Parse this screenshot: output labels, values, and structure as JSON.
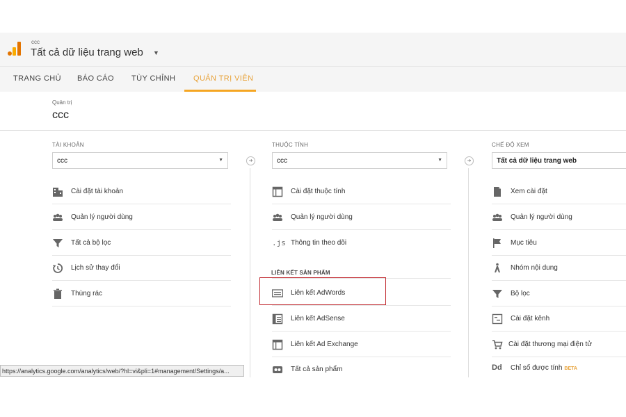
{
  "header": {
    "account_small": "ccc",
    "view_title": "Tất cả dữ liệu trang web"
  },
  "tabs": [
    {
      "label": "TRANG CHỦ"
    },
    {
      "label": "BÁO CÁO"
    },
    {
      "label": "TÙY CHỈNH"
    },
    {
      "label": "QUẢN TRỊ VIÊN",
      "active": true
    }
  ],
  "admin": {
    "small_label": "Quản trị",
    "name": "ccc"
  },
  "account_col": {
    "title": "TÀI KHOẢN",
    "selected": "ccc",
    "items": [
      {
        "label": "Cài đặt tài khoản",
        "icon": "building-icon"
      },
      {
        "label": "Quản lý người dùng",
        "icon": "users-icon"
      },
      {
        "label": "Tất cả bộ lọc",
        "icon": "filter-icon"
      },
      {
        "label": "Lịch sử thay đổi",
        "icon": "history-icon"
      },
      {
        "label": "Thùng rác",
        "icon": "trash-icon"
      }
    ]
  },
  "property_col": {
    "title": "THUỘC TÍNH",
    "selected": "ccc",
    "items": [
      {
        "label": "Cài đặt thuộc tính",
        "icon": "window-icon"
      },
      {
        "label": "Quản lý người dùng",
        "icon": "users-icon"
      },
      {
        "label": "Thông tin theo dõi",
        "icon": "js-icon",
        "icon_text": ".js"
      }
    ],
    "section_label": "LIÊN KẾT SẢN PHẨM",
    "product_links": [
      {
        "label": "Liên kết AdWords",
        "icon": "adwords-icon"
      },
      {
        "label": "Liên kết AdSense",
        "icon": "adsense-icon"
      },
      {
        "label": "Liên kết Ad Exchange",
        "icon": "adexchange-icon"
      },
      {
        "label": "Tất cả sản phẩm",
        "icon": "all-products-icon"
      }
    ]
  },
  "view_col": {
    "title": "CHẾ ĐỘ XEM",
    "selected": "Tất cả dữ liệu trang web",
    "items": [
      {
        "label": "Xem cài đặt",
        "icon": "document-icon"
      },
      {
        "label": "Quản lý người dùng",
        "icon": "users-icon"
      },
      {
        "label": "Mục tiêu",
        "icon": "flag-icon"
      },
      {
        "label": "Nhóm nội dung",
        "icon": "person-walk-icon"
      },
      {
        "label": "Bộ lọc",
        "icon": "filter-icon"
      },
      {
        "label": "Cài đặt kênh",
        "icon": "channel-icon"
      },
      {
        "label": "Cài đặt thương mại điện tử",
        "icon": "cart-icon"
      },
      {
        "label": "Chỉ số được tính",
        "icon": "dd-icon",
        "icon_text": "Dd",
        "badge": "BETA"
      }
    ]
  },
  "status_bar": {
    "url": "https://analytics.google.com/analytics/web/?hl=vi&pli=1#management/Settings/a..."
  },
  "colors": {
    "accent": "#f5a623",
    "highlight_box": "#c0272d"
  }
}
